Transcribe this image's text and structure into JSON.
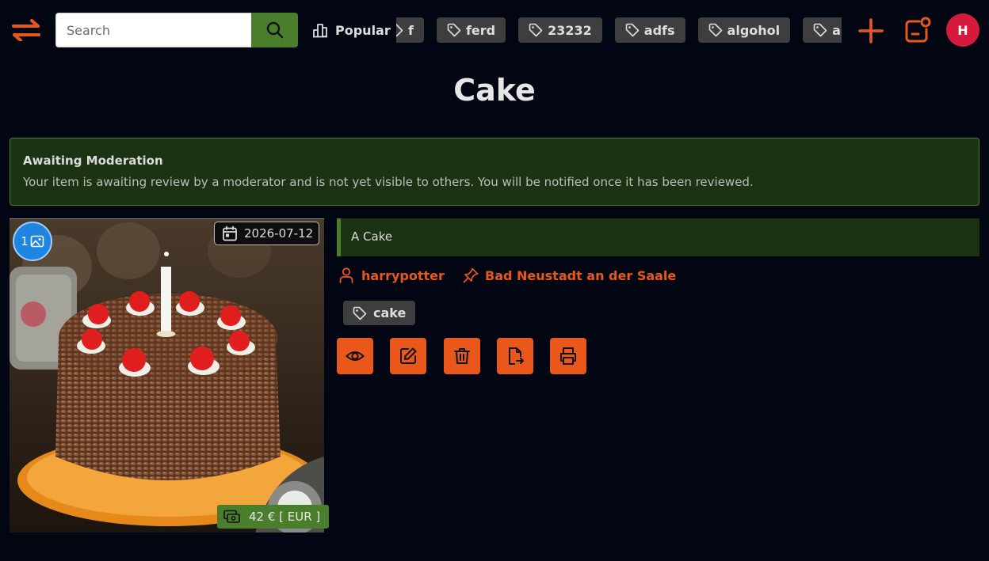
{
  "header": {
    "search_placeholder": "Search",
    "popular_label": "Popular",
    "tags": [
      "f",
      "ferd",
      "23232",
      "adfs",
      "algohol",
      "arsch"
    ],
    "avatar_initial": "H",
    "accent_color": "#e9581a",
    "green_color": "#4a7d2c"
  },
  "page_title": "Cake",
  "alert": {
    "title": "Awaiting Moderation",
    "message": "Your item is awaiting review by a moderator and is not yet visible to others. You will be notified once it has been reviewed."
  },
  "item": {
    "image_count": "1",
    "date": "2026-07-12",
    "price": "42 € [ EUR ]",
    "description": "A Cake",
    "user": "harrypotter",
    "location": "Bad Neustadt an der Saale",
    "tag": "cake"
  },
  "icons": {
    "menu": "arrows-swap-icon",
    "search": "search-icon",
    "popular": "bar-chart-icon",
    "tag": "tag-icon",
    "add": "plus-icon",
    "notifications": "bell-dot-icon",
    "gallery": "image-icon",
    "calendar": "calendar-icon",
    "money": "cash-icon",
    "user": "user-icon",
    "location": "pin-icon",
    "actions": [
      "eye-icon",
      "edit-icon",
      "trash-icon",
      "export-icon",
      "printer-icon"
    ]
  }
}
